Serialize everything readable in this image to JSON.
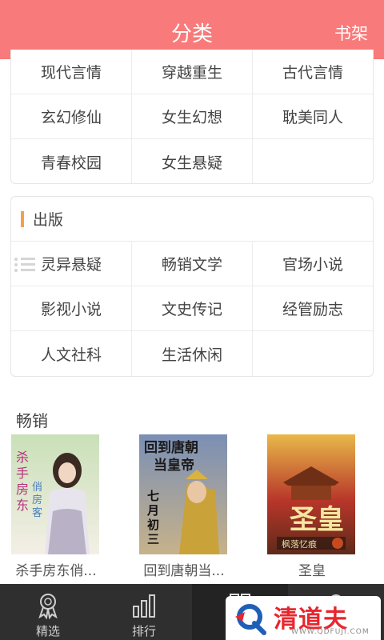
{
  "header": {
    "title": "分类",
    "shelf_label": "书架"
  },
  "female": {
    "rows": [
      [
        "现代言情",
        "穿越重生",
        "古代言情"
      ],
      [
        "玄幻修仙",
        "女生幻想",
        "耽美同人"
      ],
      [
        "青春校园",
        "女生悬疑",
        ""
      ]
    ]
  },
  "publishing": {
    "title": "出版",
    "rows": [
      [
        "灵异悬疑",
        "畅销文学",
        "官场小说"
      ],
      [
        "影视小说",
        "文史传记",
        "经管励志"
      ],
      [
        "人文社科",
        "生活休闲",
        ""
      ]
    ]
  },
  "bestsellers": {
    "title": "畅销",
    "books": [
      {
        "caption": "杀手房东俏...",
        "cover_text": "杀手房东俏房客"
      },
      {
        "caption": "回到唐朝当...",
        "cover_text": "回到唐朝当皇帝",
        "cover_author": "七月初三"
      },
      {
        "caption": "圣皇",
        "cover_text": "圣皇",
        "cover_author": "枫落忆痕"
      }
    ]
  },
  "tabbar": {
    "tabs": [
      {
        "label": "精选",
        "icon": "medal-icon"
      },
      {
        "label": "排行",
        "icon": "bar-chart-icon"
      },
      {
        "label": "",
        "icon": "grid-icon",
        "active": true
      },
      {
        "label": "",
        "icon": "search-icon"
      }
    ]
  },
  "watermark": {
    "name": "清道夫",
    "url": "WWW.QDFUJI.COM"
  },
  "colors": {
    "header": "#f87a7a",
    "accent": "#f5a04a",
    "tabbar": "#2f2f2f",
    "watermark": "#e8262d"
  }
}
